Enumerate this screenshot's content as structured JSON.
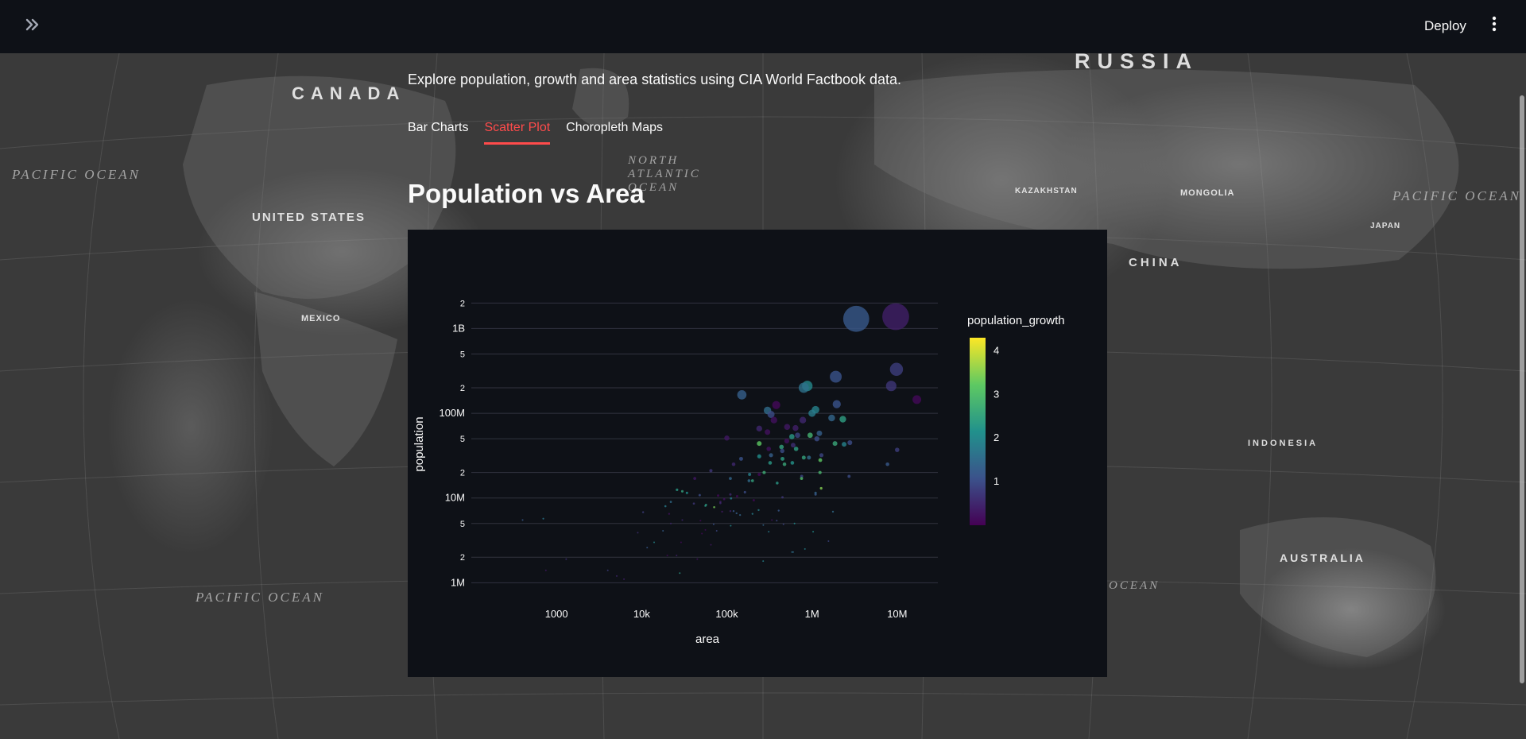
{
  "header": {
    "expand_icon": "double-chevron-right-icon",
    "deploy_label": "Deploy",
    "menu_icon": "vertical-dots-icon"
  },
  "background_map": {
    "labels": [
      "RUSSIA",
      "CANADA",
      "UNITED STATES",
      "CHINA",
      "AUSTRALIA",
      "MONGOLIA",
      "KAZAKHSTAN",
      "INDONESIA",
      "MEXICO",
      "JAPAN"
    ],
    "oceans": [
      "PACIFIC OCEAN",
      "PACIFIC OCEAN",
      "PACIFIC OCEAN",
      "NORTH ATLANTIC OCEAN",
      "OCEAN"
    ]
  },
  "main": {
    "subtitle": "Explore population, growth and area statistics using CIA World Factbook data.",
    "tabs": [
      {
        "label": "Bar Charts",
        "active": false
      },
      {
        "label": "Scatter Plot",
        "active": true
      },
      {
        "label": "Choropleth Maps",
        "active": false
      }
    ],
    "heading": "Population vs Area"
  },
  "chart_data": {
    "type": "scatter",
    "xlabel": "area",
    "ylabel": "population",
    "x_scale": "log",
    "y_scale": "log",
    "xlim": [
      100,
      30000000
    ],
    "ylim": [
      600000,
      2500000000
    ],
    "x_ticks": [
      {
        "v": 1000,
        "t": "1000"
      },
      {
        "v": 10000,
        "t": "10k"
      },
      {
        "v": 100000,
        "t": "100k"
      },
      {
        "v": 1000000,
        "t": "1M"
      },
      {
        "v": 10000000,
        "t": "10M"
      }
    ],
    "y_ticks": [
      {
        "v": 1000000,
        "t": "1M"
      },
      {
        "v": 2000000,
        "t": "2"
      },
      {
        "v": 5000000,
        "t": "5"
      },
      {
        "v": 10000000,
        "t": "10M"
      },
      {
        "v": 20000000,
        "t": "2"
      },
      {
        "v": 50000000,
        "t": "5"
      },
      {
        "v": 100000000,
        "t": "100M"
      },
      {
        "v": 200000000,
        "t": "2"
      },
      {
        "v": 500000000,
        "t": "5"
      },
      {
        "v": 1000000000,
        "t": "1B"
      },
      {
        "v": 2000000000,
        "t": "2"
      }
    ],
    "color_scale": {
      "name": "population_growth",
      "min": 0,
      "max": 4.3,
      "ticks": [
        1,
        2,
        3,
        4
      ],
      "colors": [
        "#440154",
        "#3b528b",
        "#21918c",
        "#5ec962",
        "#fde725"
      ]
    },
    "grid": true,
    "points": [
      {
        "x": 9600000,
        "y": 1380000000,
        "g": 0.4
      },
      {
        "x": 3300000,
        "y": 1300000000,
        "g": 1.2
      },
      {
        "x": 9800000,
        "y": 330000000,
        "g": 0.8
      },
      {
        "x": 1900000,
        "y": 270000000,
        "g": 1.1
      },
      {
        "x": 8500000,
        "y": 210000000,
        "g": 0.7
      },
      {
        "x": 880000,
        "y": 210000000,
        "g": 2.0
      },
      {
        "x": 800000,
        "y": 200000000,
        "g": 1.6
      },
      {
        "x": 150000,
        "y": 165000000,
        "g": 1.3
      },
      {
        "x": 17000000,
        "y": 145000000,
        "g": 0.1
      },
      {
        "x": 380000,
        "y": 125000000,
        "g": 0.1
      },
      {
        "x": 1100000,
        "y": 110000000,
        "g": 1.9
      },
      {
        "x": 1950000,
        "y": 128000000,
        "g": 1.1
      },
      {
        "x": 300000,
        "y": 108000000,
        "g": 1.5
      },
      {
        "x": 330000,
        "y": 97000000,
        "g": 1.0
      },
      {
        "x": 1000000,
        "y": 100000000,
        "g": 1.8
      },
      {
        "x": 2300000,
        "y": 85000000,
        "g": 2.4
      },
      {
        "x": 1700000,
        "y": 88000000,
        "g": 1.4
      },
      {
        "x": 780000,
        "y": 83000000,
        "g": 0.5
      },
      {
        "x": 357000,
        "y": 83000000,
        "g": 0.2
      },
      {
        "x": 510000,
        "y": 69000000,
        "g": 0.3
      },
      {
        "x": 640000,
        "y": 67000000,
        "g": 0.4
      },
      {
        "x": 240000,
        "y": 66000000,
        "g": 0.5
      },
      {
        "x": 300000,
        "y": 60000000,
        "g": 0.2
      },
      {
        "x": 1220000,
        "y": 58000000,
        "g": 1.3
      },
      {
        "x": 950000,
        "y": 55000000,
        "g": 2.8
      },
      {
        "x": 580000,
        "y": 53000000,
        "g": 2.3
      },
      {
        "x": 677000,
        "y": 55000000,
        "g": 0.9
      },
      {
        "x": 100000,
        "y": 51000000,
        "g": 0.3
      },
      {
        "x": 1140000,
        "y": 50000000,
        "g": 1.0
      },
      {
        "x": 2780000,
        "y": 45000000,
        "g": 1.0
      },
      {
        "x": 600000,
        "y": 42000000,
        "g": 0.6
      },
      {
        "x": 505000,
        "y": 47000000,
        "g": 0.2
      },
      {
        "x": 1860000,
        "y": 44000000,
        "g": 2.6
      },
      {
        "x": 438000,
        "y": 40000000,
        "g": 2.5
      },
      {
        "x": 240000,
        "y": 44000000,
        "g": 3.2
      },
      {
        "x": 2380000,
        "y": 43000000,
        "g": 1.9
      },
      {
        "x": 650000,
        "y": 38000000,
        "g": 2.4
      },
      {
        "x": 447000,
        "y": 36000000,
        "g": 1.0
      },
      {
        "x": 310000,
        "y": 38000000,
        "g": 0.2
      },
      {
        "x": 9980000,
        "y": 37000000,
        "g": 0.8
      },
      {
        "x": 330000,
        "y": 32000000,
        "g": 1.3
      },
      {
        "x": 1290000,
        "y": 32000000,
        "g": 0.9
      },
      {
        "x": 920000,
        "y": 30000000,
        "g": 1.5
      },
      {
        "x": 240000,
        "y": 31000000,
        "g": 2.1
      },
      {
        "x": 450000,
        "y": 29000000,
        "g": 2.4
      },
      {
        "x": 800000,
        "y": 30000000,
        "g": 2.5
      },
      {
        "x": 147000,
        "y": 29000000,
        "g": 1.1
      },
      {
        "x": 1250000,
        "y": 28000000,
        "g": 3.2
      },
      {
        "x": 587000,
        "y": 26000000,
        "g": 2.2
      },
      {
        "x": 475000,
        "y": 25000000,
        "g": 2.6
      },
      {
        "x": 322000,
        "y": 26000000,
        "g": 2.3
      },
      {
        "x": 120000,
        "y": 25000000,
        "g": 0.5
      },
      {
        "x": 7690000,
        "y": 25000000,
        "g": 1.2
      },
      {
        "x": 274000,
        "y": 20000000,
        "g": 2.7
      },
      {
        "x": 1240000,
        "y": 20000000,
        "g": 2.9
      },
      {
        "x": 756000,
        "y": 18000000,
        "g": 0.9
      },
      {
        "x": 185000,
        "y": 19000000,
        "g": 1.9
      },
      {
        "x": 240000,
        "y": 19000000,
        "g": 0.1
      },
      {
        "x": 65000,
        "y": 21000000,
        "g": 0.7
      },
      {
        "x": 2720000,
        "y": 18000000,
        "g": 1.0
      },
      {
        "x": 110000,
        "y": 17000000,
        "g": 1.4
      },
      {
        "x": 200000,
        "y": 16000000,
        "g": 2.5
      },
      {
        "x": 182000,
        "y": 16000000,
        "g": 1.5
      },
      {
        "x": 390000,
        "y": 15000000,
        "g": 2.3
      },
      {
        "x": 753000,
        "y": 17000000,
        "g": 3.0
      },
      {
        "x": 1280000,
        "y": 13000000,
        "g": 3.5
      },
      {
        "x": 42000,
        "y": 17000000,
        "g": 0.3
      },
      {
        "x": 34000,
        "y": 11500000,
        "g": 2.1
      },
      {
        "x": 30000,
        "y": 12000000,
        "g": 2.5
      },
      {
        "x": 26000,
        "y": 12500000,
        "g": 2.3
      },
      {
        "x": 163000,
        "y": 11700000,
        "g": 1.0
      },
      {
        "x": 1100000,
        "y": 11500000,
        "g": 1.4
      },
      {
        "x": 110000,
        "y": 11000000,
        "g": 0.5
      },
      {
        "x": 48000,
        "y": 10800000,
        "g": 1.0
      },
      {
        "x": 79000,
        "y": 10700000,
        "g": 0.1
      },
      {
        "x": 132000,
        "y": 10500000,
        "g": 0.1
      },
      {
        "x": 93000,
        "y": 9700000,
        "g": 0.2
      },
      {
        "x": 450000,
        "y": 10200000,
        "g": 0.7
      },
      {
        "x": 207000,
        "y": 9400000,
        "g": 0.1
      },
      {
        "x": 84000,
        "y": 9000000,
        "g": 0.4
      },
      {
        "x": 22000,
        "y": 9000000,
        "g": 1.5
      },
      {
        "x": 1100000,
        "y": 11000000,
        "g": 1.2
      },
      {
        "x": 84000,
        "y": 8700000,
        "g": 0.5
      },
      {
        "x": 41000,
        "y": 8600000,
        "g": 0.7
      },
      {
        "x": 112000,
        "y": 9900000,
        "g": 1.8
      },
      {
        "x": 56000,
        "y": 8100000,
        "g": 2.3
      },
      {
        "x": 19000,
        "y": 8000000,
        "g": 1.8
      },
      {
        "x": 110000,
        "y": 7000000,
        "g": 0.4
      },
      {
        "x": 236000,
        "y": 7200000,
        "g": 1.9
      },
      {
        "x": 120000,
        "y": 7000000,
        "g": 1.2
      },
      {
        "x": 71000,
        "y": 7800000,
        "g": 3.4
      },
      {
        "x": 406000,
        "y": 7100000,
        "g": 1.2
      },
      {
        "x": 1760000,
        "y": 6900000,
        "g": 1.5
      },
      {
        "x": 88000,
        "y": 6900000,
        "g": 0.3
      },
      {
        "x": 21000,
        "y": 6500000,
        "g": 0.2
      },
      {
        "x": 130000,
        "y": 6600000,
        "g": 1.3
      },
      {
        "x": 143000,
        "y": 6300000,
        "g": 1.4
      },
      {
        "x": 10400,
        "y": 6800000,
        "g": 0.8
      },
      {
        "x": 57000,
        "y": 8300000,
        "g": 2.4
      },
      {
        "x": 200000,
        "y": 6500000,
        "g": 1.8
      },
      {
        "x": 30000,
        "y": 5500000,
        "g": 0.5
      },
      {
        "x": 49000,
        "y": 5400000,
        "g": 0.1
      },
      {
        "x": 338000,
        "y": 5500000,
        "g": 0.2
      },
      {
        "x": 385000,
        "y": 5400000,
        "g": 0.9
      },
      {
        "x": 623000,
        "y": 5000000,
        "g": 2.1
      },
      {
        "x": 462000,
        "y": 4900000,
        "g": 0.9
      },
      {
        "x": 70000,
        "y": 4900000,
        "g": 1.1
      },
      {
        "x": 268000,
        "y": 4800000,
        "g": 1.4
      },
      {
        "x": 111000,
        "y": 4700000,
        "g": 2.0
      },
      {
        "x": 22000,
        "y": 5000000,
        "g": 0.5
      },
      {
        "x": 56000,
        "y": 4200000,
        "g": 0.1
      },
      {
        "x": 76000,
        "y": 4100000,
        "g": 0.9
      },
      {
        "x": 310000,
        "y": 4000000,
        "g": 1.8
      },
      {
        "x": 1030000,
        "y": 4000000,
        "g": 2.1
      },
      {
        "x": 17800,
        "y": 4100000,
        "g": 1.3
      },
      {
        "x": 51000,
        "y": 3800000,
        "g": 0.1
      },
      {
        "x": 9000,
        "y": 3900000,
        "g": 0.6
      },
      {
        "x": 825000,
        "y": 2500000,
        "g": 1.9
      },
      {
        "x": 65000,
        "y": 2800000,
        "g": 0.3
      },
      {
        "x": 1560000,
        "y": 3100000,
        "g": 0.9
      },
      {
        "x": 29000,
        "y": 3000000,
        "g": 0.1
      },
      {
        "x": 11600,
        "y": 2600000,
        "g": 1.2
      },
      {
        "x": 25700,
        "y": 2100000,
        "g": 0.4
      },
      {
        "x": 20000,
        "y": 2100000,
        "g": 0.1
      },
      {
        "x": 1300,
        "y": 1900000,
        "g": 0.6
      },
      {
        "x": 600000,
        "y": 2300000,
        "g": 1.5
      },
      {
        "x": 581000,
        "y": 2300000,
        "g": 1.6
      },
      {
        "x": 45000,
        "y": 1900000,
        "g": 0.2
      },
      {
        "x": 4000,
        "y": 1400000,
        "g": 0.8
      },
      {
        "x": 28000,
        "y": 1300000,
        "g": 2.3
      },
      {
        "x": 267000,
        "y": 1800000,
        "g": 1.9
      },
      {
        "x": 700,
        "y": 5700000,
        "g": 1.7
      },
      {
        "x": 750,
        "y": 1400000,
        "g": 0.3
      },
      {
        "x": 5100,
        "y": 1200000,
        "g": 0.5
      },
      {
        "x": 14000,
        "y": 3000000,
        "g": 2.0
      },
      {
        "x": 6200,
        "y": 1100000,
        "g": 0.4
      },
      {
        "x": 400,
        "y": 5500000,
        "g": 1.2
      }
    ]
  }
}
